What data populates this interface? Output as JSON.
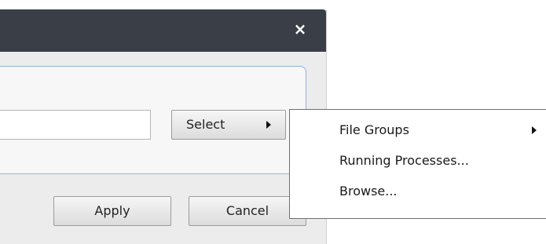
{
  "dialog": {
    "close_glyph": "×",
    "path_input": {
      "value": "",
      "placeholder": ""
    },
    "select_label": "Select",
    "apply_label": "Apply",
    "cancel_label": "Cancel"
  },
  "menu": {
    "items": [
      {
        "label": "File Groups",
        "has_submenu": true
      },
      {
        "label": "Running Processes...",
        "has_submenu": false
      },
      {
        "label": "Browse...",
        "has_submenu": false
      }
    ]
  },
  "colors": {
    "titlebar": "#3a3f47",
    "dialog_background": "#ececec",
    "group_border": "#8fb4d9",
    "menu_background": "#ffffff"
  }
}
